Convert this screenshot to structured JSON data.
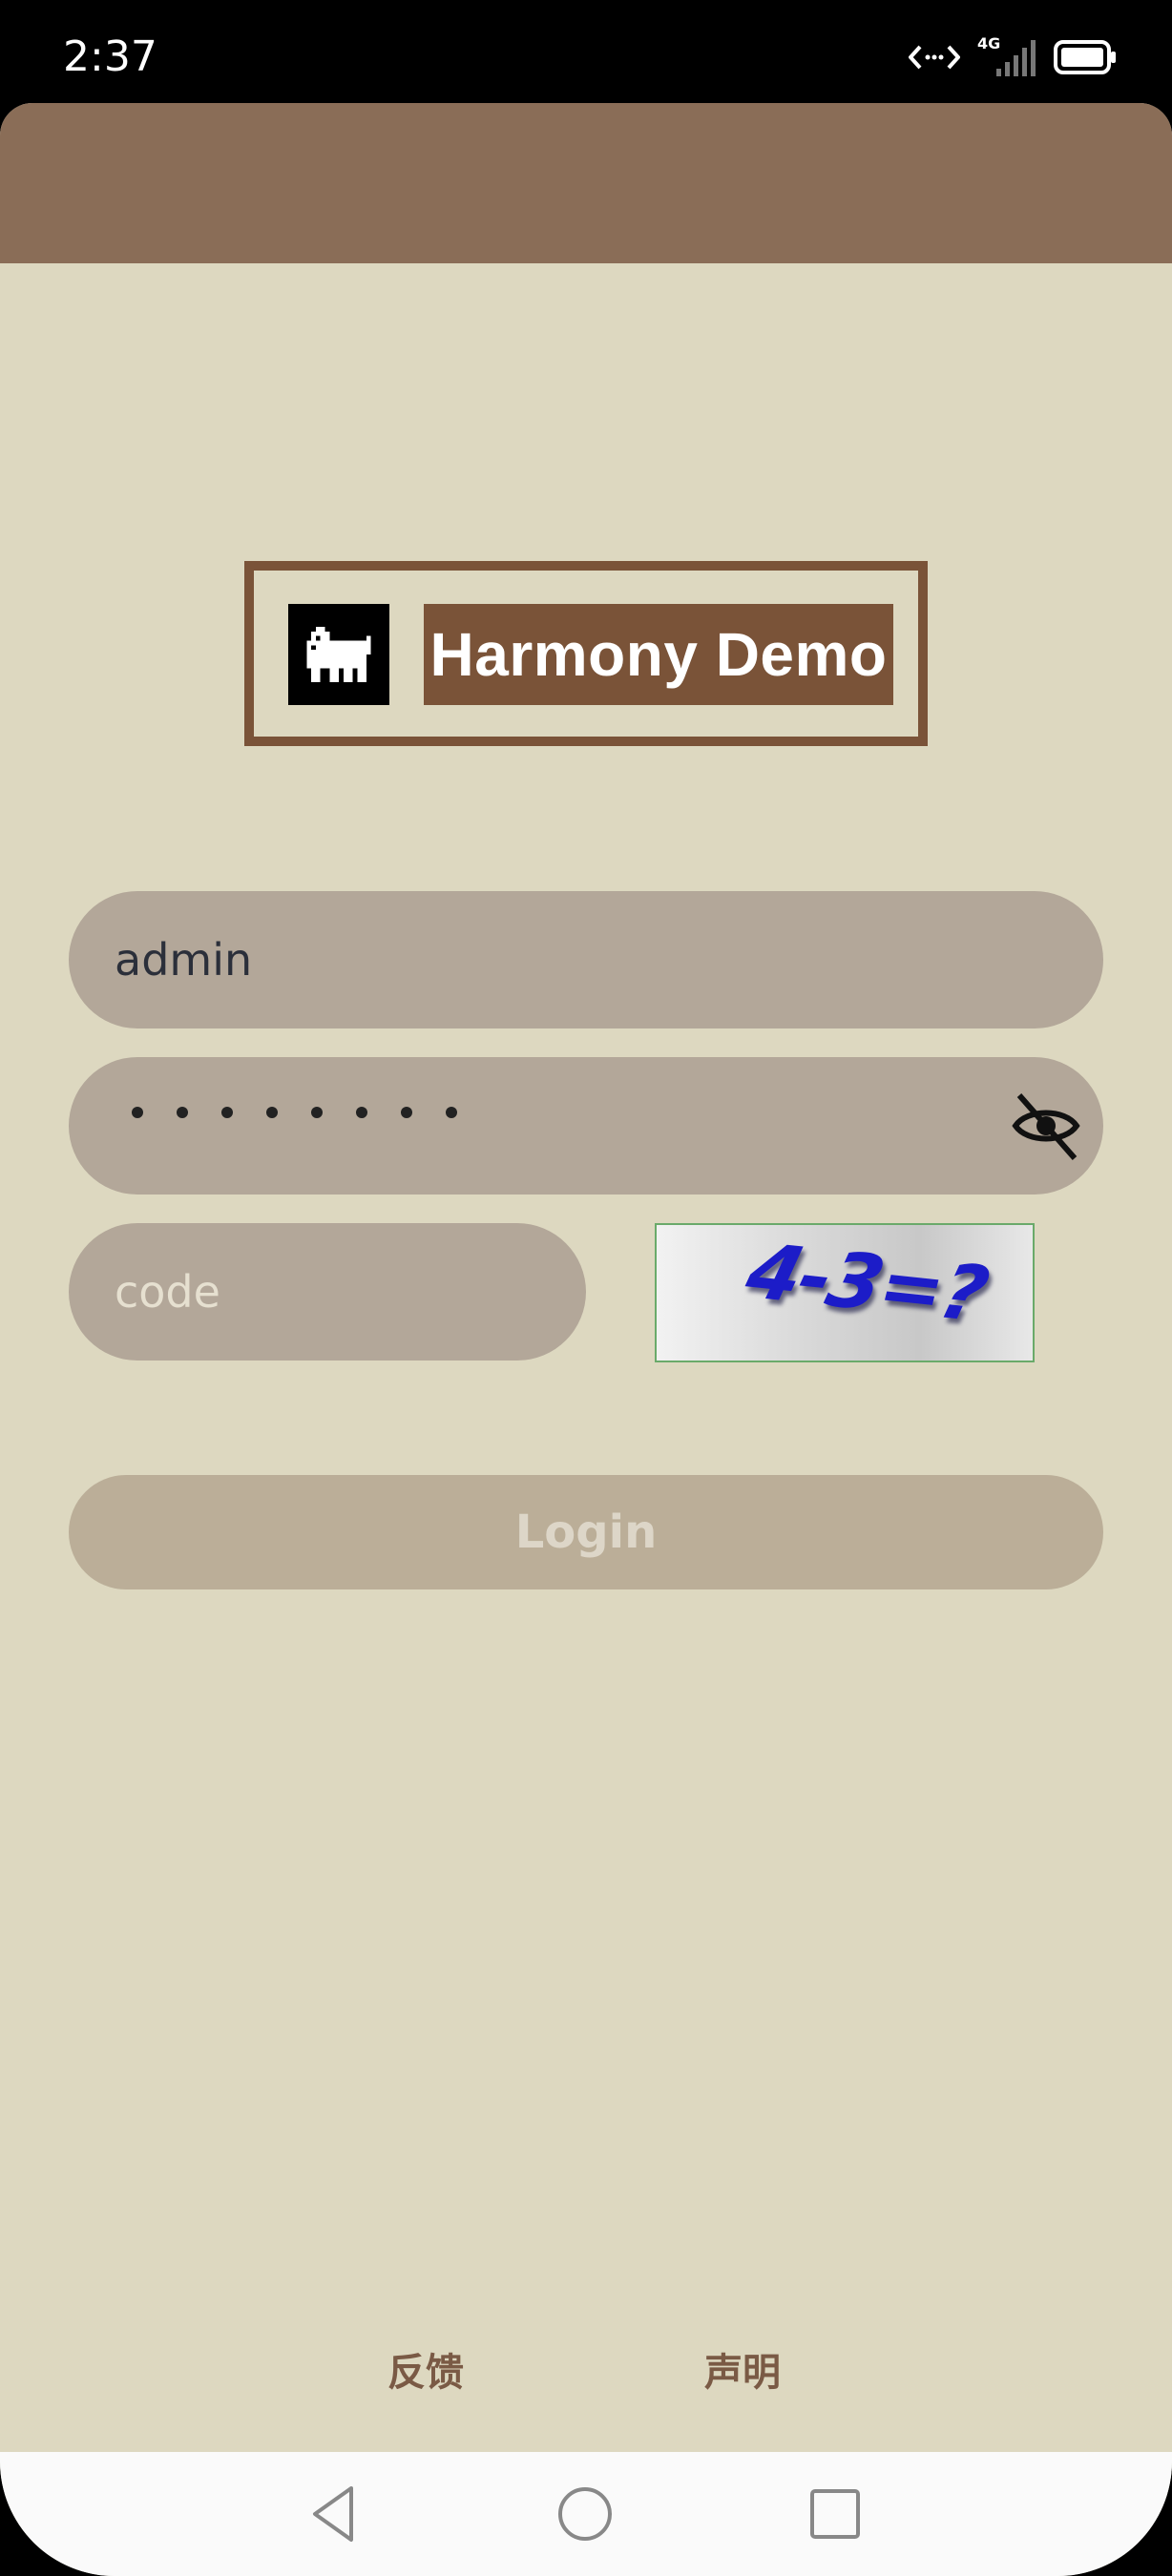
{
  "status_bar": {
    "time": "2:37",
    "network_label": "4G",
    "icons": [
      "data-transfer-icon",
      "cellular-signal-icon",
      "battery-icon"
    ]
  },
  "app": {
    "title": "Harmony Demo",
    "logo_icon": "pixel-dog-icon",
    "colors": {
      "background": "#ddd8c0",
      "top_bar": "#8a6d57",
      "brand": "#7a5338",
      "input_bg": "#b3a799",
      "button_bg": "#bbae98"
    }
  },
  "form": {
    "username_value": "admin",
    "password_length": 8,
    "code_placeholder": "code",
    "captcha_text": "4-3=?",
    "login_label": "Login"
  },
  "footer": {
    "feedback_label": "反馈",
    "statement_label": "声明"
  },
  "nav": {
    "icons": [
      "back-icon",
      "home-icon",
      "recents-icon"
    ]
  }
}
